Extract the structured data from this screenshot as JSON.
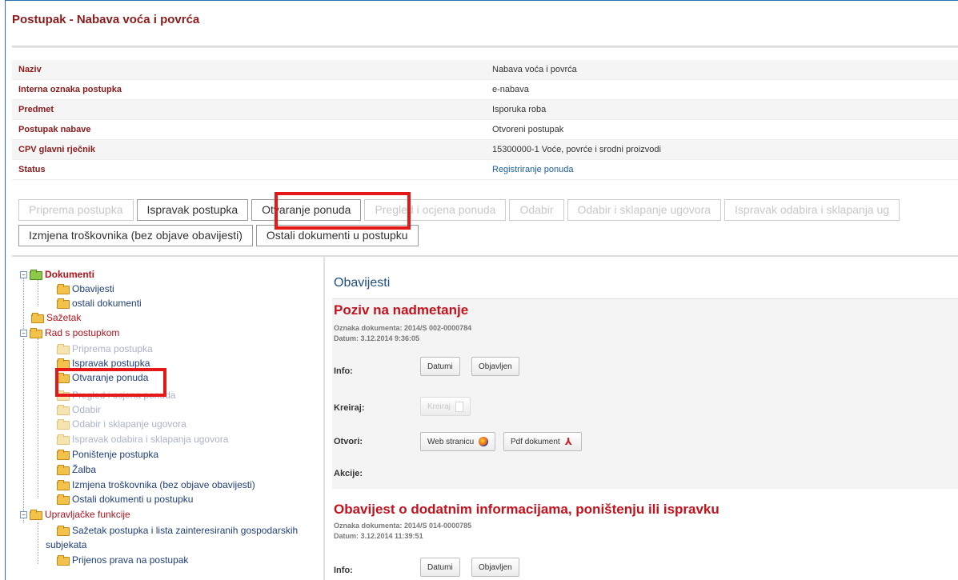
{
  "page_title": "Postupak - Nabava voća i povrća",
  "info_rows": [
    {
      "key": "Naziv",
      "value": "Nabava voća i povrća"
    },
    {
      "key": "Interna oznaka postupka",
      "value": "e-nabava"
    },
    {
      "key": "Predmet",
      "value": "Isporuka roba"
    },
    {
      "key": "Postupak nabave",
      "value": "Otvoreni postupak"
    },
    {
      "key": "CPV glavni rječnik",
      "value": "15300000-1 Voće, povrće i srodni proizvodi"
    },
    {
      "key": "Status",
      "value": "Registriranje ponuda"
    }
  ],
  "tabs_row1": [
    "Priprema postupka",
    "Ispravak postupka",
    "Otvaranje ponuda",
    "Pregled i ocjena ponuda",
    "Odabir",
    "Odabir i sklapanje ugovora",
    "Ispravak odabira i sklapanja ug"
  ],
  "tabs_row2": [
    "Izmjena troškovnika (bez objave obavijesti)",
    "Ostali dokumenti u postupku"
  ],
  "tree": {
    "dokumenti": "Dokumenti",
    "obavijesti": "Obavijesti",
    "ostali": "ostali dokumenti",
    "sazetak": "Sažetak",
    "rad": "Rad s postupkom",
    "priprema": "Priprema postupka",
    "ispravak": "Ispravak postupka",
    "otvaranje": "Otvaranje ponuda",
    "pregled": "Pregled i ocjena ponuda",
    "odabir": "Odabir",
    "odabir_skl": "Odabir i sklapanje ugovora",
    "ispravak_odabira": "Ispravak odabira i sklapanja ugovora",
    "ponistenje": "Poništenje postupka",
    "zalba": "Žalba",
    "izmjena": "Izmjena troškovnika (bez objave obavijesti)",
    "ostali_dok": "Ostali dokumenti u postupku",
    "upravljacke": "Upravljačke funkcije",
    "sazetak_lista_1": "Sažetak postupka i lista zainteresiranih gospodarskih",
    "sazetak_lista_2": "subjekata",
    "prijenos": "Prijenos prava na postupak"
  },
  "content": {
    "heading": "Obavijesti",
    "sections": [
      {
        "title": "Poziv na nadmetanje",
        "oznaka": "Oznaka dokumenta: 2014/S 002-0000784",
        "datum": "Datum: 3.12.2014 9:36:05"
      },
      {
        "title": "Obavijest o dodatnim informacijama, poništenju ili ispravku",
        "oznaka": "Oznaka dokumenta: 2014/S 014-0000785",
        "datum": "Datum: 3.12.2014 11:39:51"
      }
    ],
    "labels": {
      "info": "Info:",
      "kreiraj": "Kreiraj:",
      "otvori": "Otvori:",
      "akcije": "Akcije:"
    },
    "buttons": {
      "datumi": "Datumi",
      "objavljen": "Objavljen",
      "kreiraj": "Kreiraj",
      "web": "Web stranicu",
      "pdf": "Pdf dokument"
    }
  },
  "colors": {
    "title": "#8b1a1a",
    "accent_red": "#c4121d",
    "highlight": "#e61717",
    "link": "#1d5c9a"
  }
}
